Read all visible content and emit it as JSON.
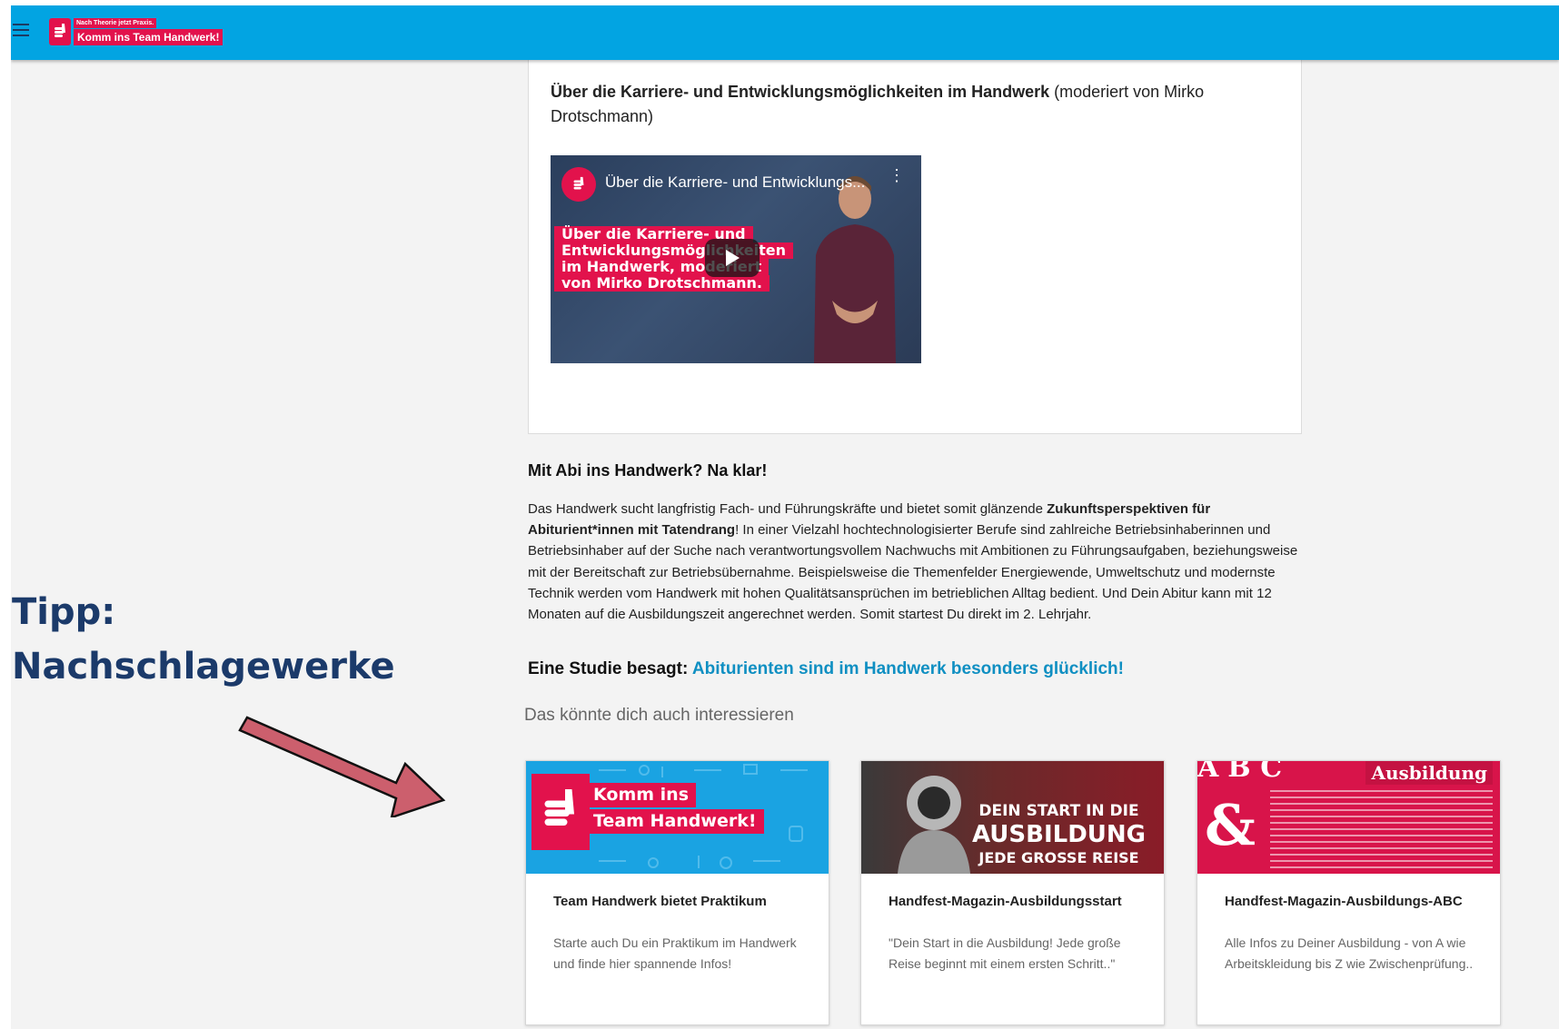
{
  "header": {
    "logo_small": "Nach Theorie jetzt Praxis.",
    "logo_main": "Komm ins Team Handwerk!",
    "menu_icon": "hamburger-menu-icon"
  },
  "video_section": {
    "title_bold": "Über die Karriere- und Entwicklungsmöglichkeiten im Handwerk",
    "title_rest": " (moderiert von Mirko Drotschmann)",
    "video_heading": "Über die Karriere- und Entwicklungs...",
    "overlay_lines": [
      "Über die Karriere- und",
      "Entwicklungsmöglichkeiten",
      "im Handwerk, moderiert",
      "von Mirko Drotschmann."
    ]
  },
  "article": {
    "heading": "Mit Abi ins Handwerk? Na klar!",
    "p_part1": "Das Handwerk sucht langfristig Fach- und Führungskräfte und bietet somit glänzende ",
    "p_bold": "Zukunftsperspektiven für Abiturient*innen mit Tatendrang",
    "p_part2": "! In einer Vielzahl hochtechnologisierter Berufe sind zahlreiche Betriebsinhaberinnen und Betriebsinhaber auf der Suche nach verantwortungsvollem Nachwuchs mit Ambitionen zu Führungsaufgaben, beziehungsweise mit der Bereitschaft zur Betriebsübernahme. Beispielsweise die Themenfelder Energiewende, Umweltschutz und modernste Technik werden vom Handwerk mit hohen Qualitätsansprüchen im betrieblichen Alltag bedient. Und Dein Abitur kann mit 12 Monaten auf die Ausbildungszeit angerechnet werden. Somit startest Du direkt im 2. Lehrjahr.",
    "study_label": "Eine Studie besagt: ",
    "study_link": "Abiturienten sind im Handwerk besonders glücklich!"
  },
  "related": {
    "heading": "Das könnte dich auch interessieren",
    "cards": [
      {
        "title": "Team Handwerk bietet Praktikum",
        "text": "Starte auch Du ein Praktikum im Handwerk und finde hier spannende Infos!",
        "img_line1": "Komm ins",
        "img_line2": "Team Handwerk!"
      },
      {
        "title": "Handfest-Magazin-Ausbildungsstart",
        "text": "\"Dein Start in die Ausbildung! Jede große Reise beginnt mit einem ersten Schritt..\"",
        "img_line1": "DEIN START IN DIE",
        "img_line2": "AUSBILDUNG",
        "img_line3": "JEDE GROSSE REISE"
      },
      {
        "title": "Handfest-Magazin-Ausbildungs-ABC",
        "text": "Alle Infos zu Deiner Ausbildung - von A wie Arbeitskleidung bis Z wie Zwischenprüfung..",
        "img_line1": "Ausbildung",
        "img_amp": "&",
        "img_top": "ABC"
      }
    ]
  },
  "annotation": {
    "line1": "Tipp:",
    "line2": "Nachschlagewerke"
  },
  "colors": {
    "topbar": "#02a4e2",
    "brand_red": "#e2124c",
    "link": "#0f8fc2",
    "annotation_text": "#1b3a6a",
    "arrow": "#cc5f6d"
  }
}
